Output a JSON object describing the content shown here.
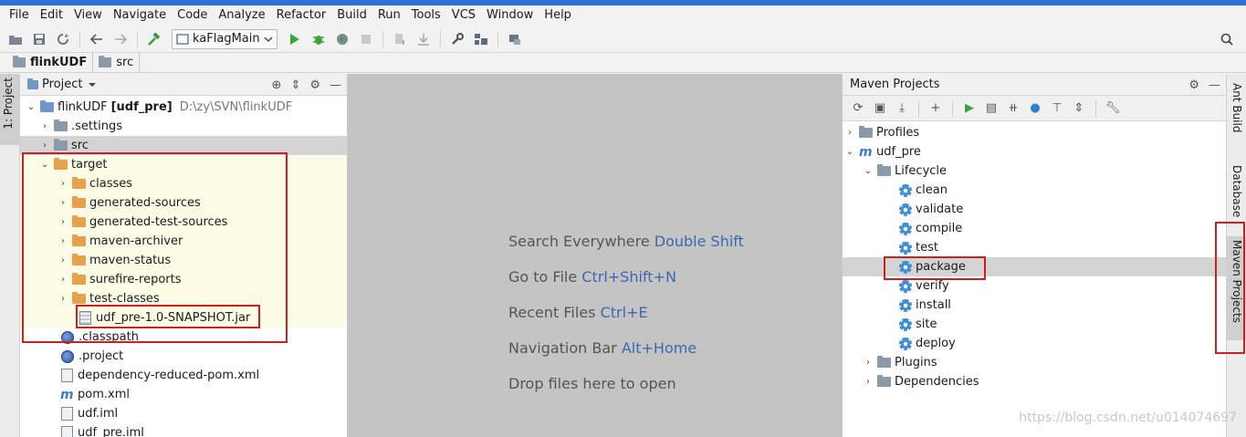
{
  "menubar": {
    "items": [
      "File",
      "Edit",
      "View",
      "Navigate",
      "Code",
      "Analyze",
      "Refactor",
      "Build",
      "Run",
      "Tools",
      "VCS",
      "Window",
      "Help"
    ]
  },
  "toolbar": {
    "run_config": "kaFlagMain"
  },
  "breadcrumb": {
    "items": [
      "flinkUDF",
      "src"
    ]
  },
  "left_strip": {
    "project_tab": "1: Project"
  },
  "project_panel": {
    "title": "Project",
    "root_name": "flinkUDF",
    "root_module": "[udf_pre]",
    "root_path": "D:\\zy\\SVN\\flinkUDF",
    "items": {
      "settings": ".settings",
      "src": "src",
      "target": "target",
      "classes": "classes",
      "generated_sources": "generated-sources",
      "generated_test_sources": "generated-test-sources",
      "maven_archiver": "maven-archiver",
      "maven_status": "maven-status",
      "surefire_reports": "surefire-reports",
      "test_classes": "test-classes",
      "jar": "udf_pre-1.0-SNAPSHOT.jar",
      "classpath": ".classpath",
      "project": ".project",
      "dependency_reduced_pom": "dependency-reduced-pom.xml",
      "pom": "pom.xml",
      "udf_iml": "udf.iml",
      "udf_pre_iml": "udf_pre.iml"
    }
  },
  "editor": {
    "hints": [
      {
        "text": "Search Everywhere",
        "key": "Double Shift"
      },
      {
        "text": "Go to File",
        "key": "Ctrl+Shift+N"
      },
      {
        "text": "Recent Files",
        "key": "Ctrl+E"
      },
      {
        "text": "Navigation Bar",
        "key": "Alt+Home"
      },
      {
        "text": "Drop files here to open",
        "key": ""
      }
    ]
  },
  "maven_panel": {
    "title": "Maven Projects",
    "profiles": "Profiles",
    "project": "udf_pre",
    "lifecycle": "Lifecycle",
    "phases": [
      "clean",
      "validate",
      "compile",
      "test",
      "package",
      "verify",
      "install",
      "site",
      "deploy"
    ],
    "plugins": "Plugins",
    "dependencies": "Dependencies"
  },
  "right_strip": {
    "ant_build": "Ant Build",
    "database": "Database",
    "maven_projects": "Maven Projects"
  },
  "watermark": "https://blog.csdn.net/u014074697",
  "colors": {
    "highlight_border": "#cc1f1f",
    "key_blue": "#3b68b0",
    "folder_orange": "#e8a04a"
  }
}
